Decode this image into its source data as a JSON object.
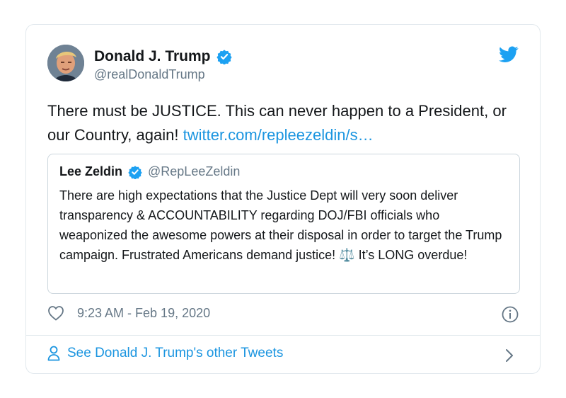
{
  "tweet": {
    "display_name": "Donald J. Trump",
    "handle": "@realDonaldTrump",
    "text_plain": "There must be JUSTICE. This can never happen to a President, or our Country, again! ",
    "link_text": "twitter.com/repleezeldin/s…",
    "timestamp": "9:23 AM - Feb 19, 2020",
    "icons": {
      "verified": "verified-badge-icon",
      "brand": "twitter-bird-icon",
      "like": "heart-icon",
      "info": "info-icon"
    }
  },
  "quoted_tweet": {
    "display_name": "Lee Zeldin",
    "handle": "@RepLeeZeldin",
    "text_before_emoji": "There are high expectations that the Justice Dept will very soon deliver transparency & ACCOUNTABILITY regarding DOJ/FBI officials who weaponized the awesome powers at their disposal in order to target the Trump campaign. Frustrated Americans demand justice! ",
    "emoji": "⚖️",
    "text_after_emoji": " It’s LONG overdue!"
  },
  "footer": {
    "link_label": "See Donald J. Trump's other Tweets",
    "icons": {
      "person": "person-icon",
      "chevron": "chevron-right-icon"
    }
  },
  "colors": {
    "link": "#1b95e0",
    "twitter_blue": "#1da1f2",
    "secondary_text": "#657786",
    "border": "#e1e8ed"
  }
}
